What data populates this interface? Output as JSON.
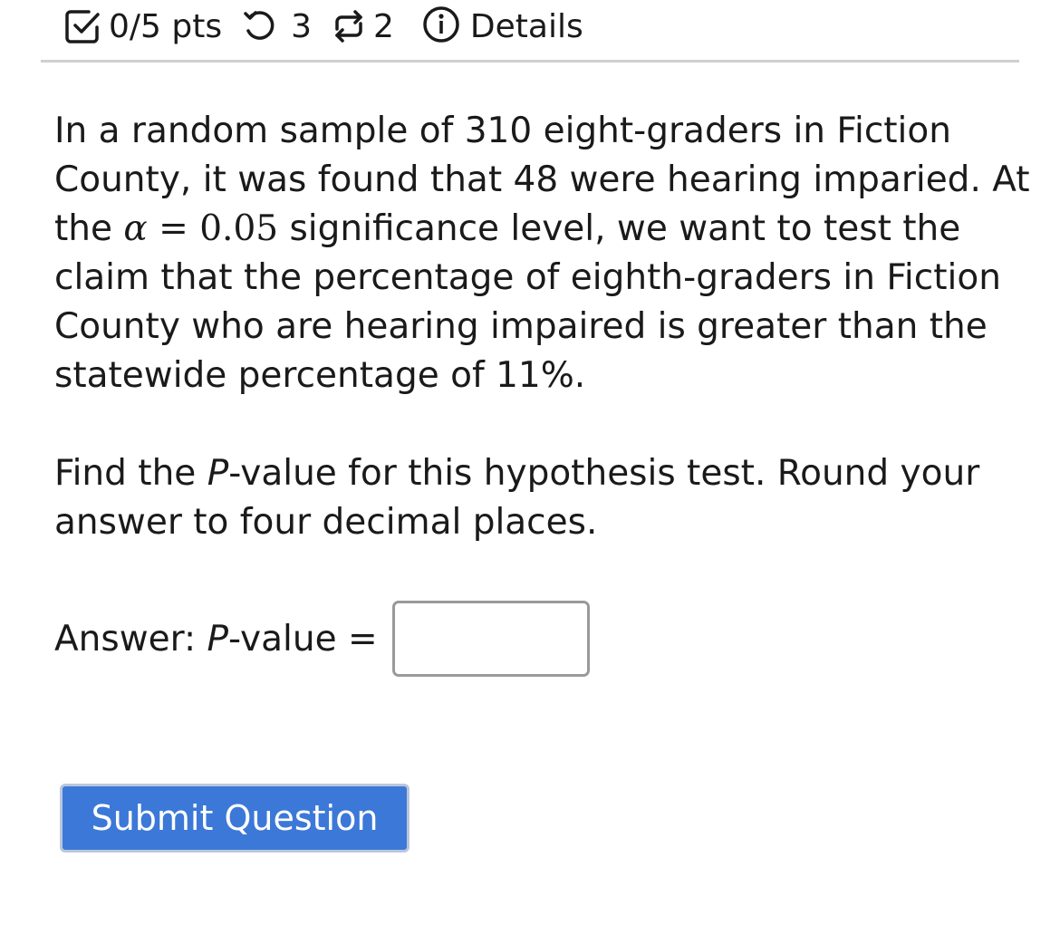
{
  "header": {
    "points_label": "0/5 pts",
    "retries": "3",
    "versions": "2",
    "details_label": "Details"
  },
  "question": {
    "line_part1": "In a random sample of 310 eight-graders in Fiction County, it was found that 48 were hearing imparied. At the ",
    "alpha_symbol": "α",
    "equals": " = ",
    "alpha_value": "0.05",
    "line_part2": " significance level, we want to test the claim that the percentage of eighth-graders in Fiction County who are hearing impaired is greater than the statewide percentage of 11%."
  },
  "prompt": {
    "part1": "Find the ",
    "p_letter": "P",
    "part2": "-value for this hypothesis test. Round your answer to four decimal places."
  },
  "answer": {
    "label_prefix": "Answer: ",
    "p_letter": "P",
    "label_suffix": "-value =",
    "input_value": ""
  },
  "submit_label": "Submit Question",
  "colors": {
    "submit_bg": "#3c78d8",
    "rule": "#cfcfcf"
  },
  "icons": [
    "checkbox-check-icon",
    "retry-icon",
    "versions-icon",
    "info-icon"
  ]
}
